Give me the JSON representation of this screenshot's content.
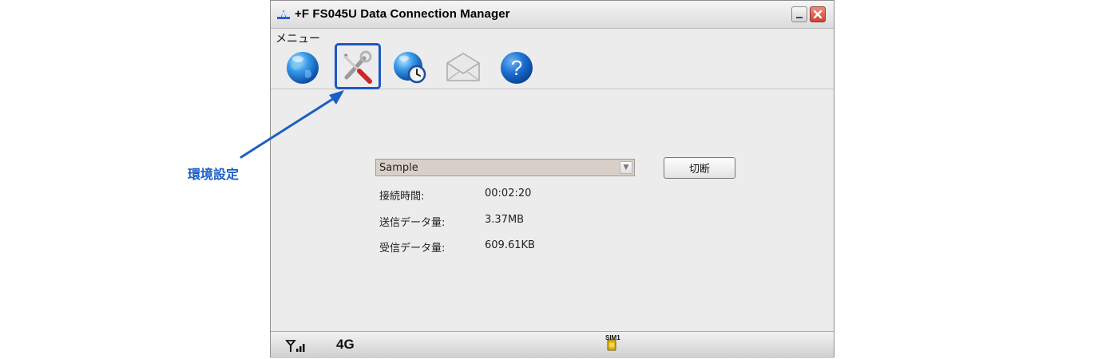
{
  "window": {
    "title": "+F FS045U Data Connection Manager"
  },
  "menu": {
    "label": "メニュー"
  },
  "toolbar": {
    "buttons": [
      {
        "icon": "globe-icon"
      },
      {
        "icon": "tools-icon"
      },
      {
        "icon": "globe-clock-icon"
      },
      {
        "icon": "envelope-icon"
      },
      {
        "icon": "help-icon"
      }
    ]
  },
  "profile": {
    "selected": "Sample"
  },
  "actions": {
    "disconnect_label": "切断"
  },
  "stats": {
    "connection_time_label": "接続時間:",
    "connection_time_value": "00:02:20",
    "sent_label": "送信データ量:",
    "sent_value": "3.37MB",
    "received_label": "受信データ量:",
    "received_value": "609.61KB"
  },
  "status": {
    "network": "4G",
    "sim_label": "SIM1"
  },
  "annotation": {
    "label": "環境設定"
  },
  "colors": {
    "highlight": "#1d57c4",
    "annotation_text": "#1b5fc5"
  }
}
